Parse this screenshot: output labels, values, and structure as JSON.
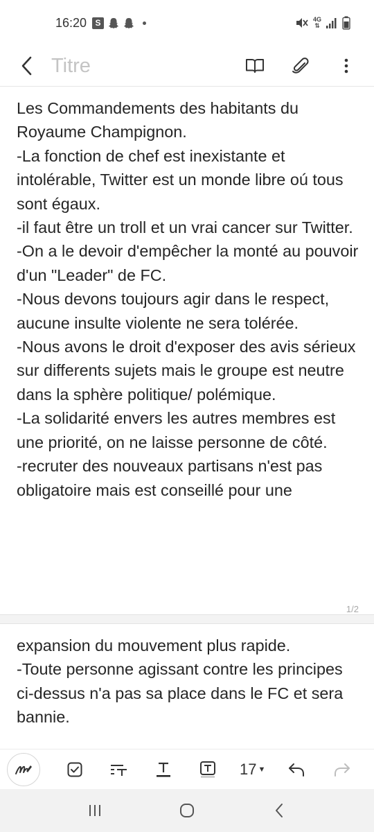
{
  "status_bar": {
    "time": "16:20",
    "app_badge": "S",
    "network": "4G",
    "icons": [
      "samsung-s-icon",
      "snapchat-icon",
      "snapchat-icon",
      "notification-dot-icon",
      "mute-icon",
      "4g-icon",
      "signal-icon",
      "battery-icon"
    ]
  },
  "app_bar": {
    "title_placeholder": "Titre",
    "icons": [
      "back-icon",
      "reading-mode-icon",
      "attach-icon",
      "more-options-icon"
    ]
  },
  "note": {
    "page1_text": "Les Commandements des habitants du Royaume Champignon.\n-La fonction de chef est inexistante et intolérable, Twitter est un monde libre oú tous sont égaux.\n-il faut être un troll et un vrai cancer sur Twitter.\n-On a le devoir d'empêcher la monté au pouvoir d'un \"Leader\" de FC.\n-Nous devons toujours agir dans le respect, aucune insulte violente ne sera tolérée.\n-Nous avons le droit d'exposer des avis sérieux sur differents sujets mais le groupe est neutre dans la sphère politique/ polémique.\n-La solidarité envers les autres membres est une priorité, on ne laisse personne de côté.\n-recruter des nouveaux partisans n'est pas obligatoire mais est conseillé pour une",
    "page2_text": "expansion du mouvement plus rapide.\n-Toute personne agissant contre les principes ci-dessus n'a pas sa place dans le FC et sera bannie.",
    "page_indicator": "1/2"
  },
  "toolbar": {
    "font_size": "17",
    "icons": [
      "handwriting-pen-icon",
      "checkbox-icon",
      "paragraph-style-icon",
      "text-color-icon",
      "text-background-icon",
      "undo-icon",
      "redo-icon"
    ]
  },
  "nav_bar": {
    "icons": [
      "recent-apps-icon",
      "home-icon",
      "nav-back-icon"
    ]
  },
  "colors": {
    "text": "#262626",
    "placeholder": "#c4c4c4",
    "nav_background": "#f2f2f2"
  }
}
